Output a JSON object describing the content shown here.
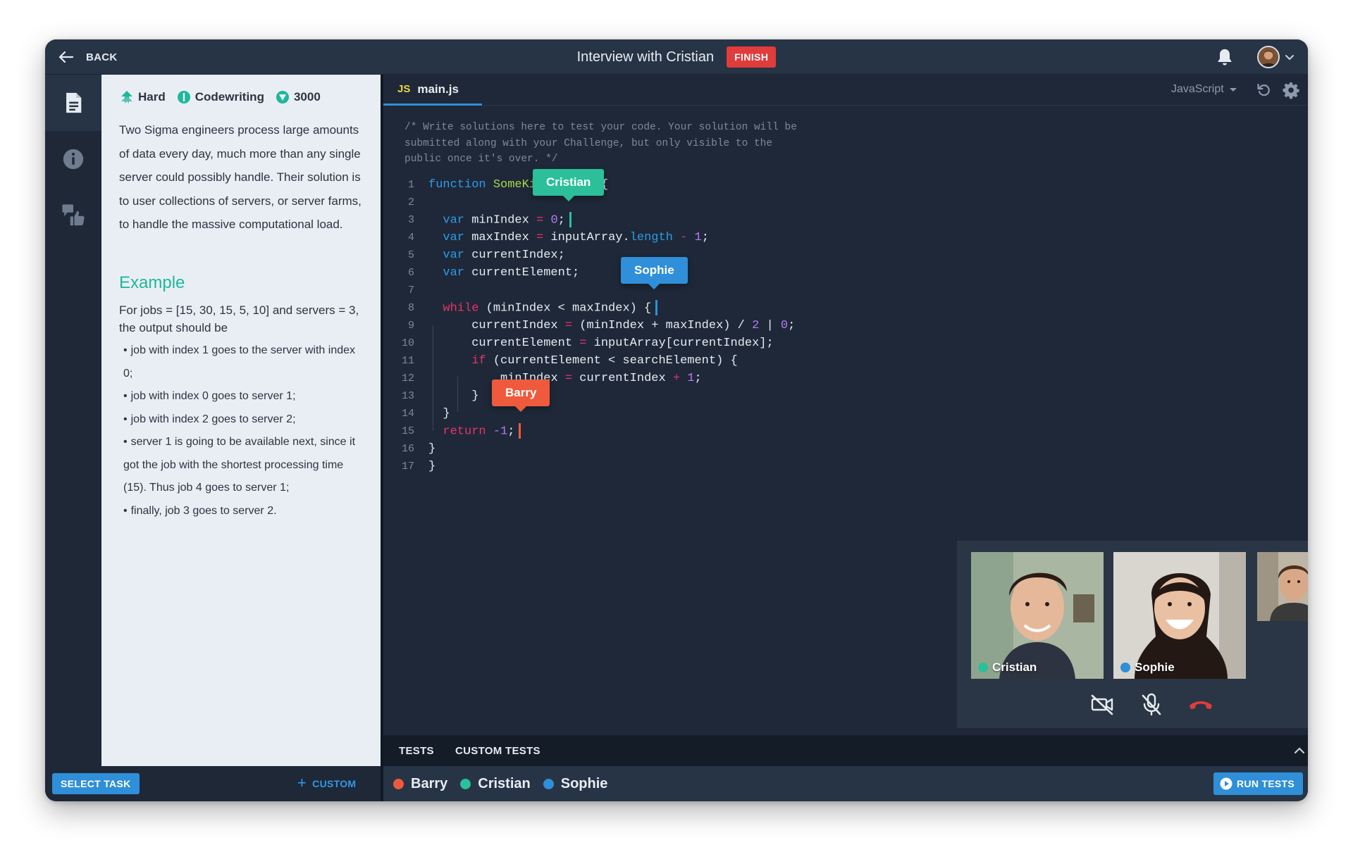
{
  "header": {
    "back_label": "BACK",
    "title": "Interview with Cristian",
    "finish_label": "FINISH"
  },
  "task": {
    "difficulty": "Hard",
    "category": "Codewriting",
    "points": "3000",
    "description": "Two Sigma engineers process large amounts of data every day, much more than any single server could possibly handle. Their solution is to user collections of servers, or server farms, to handle the massive computational load.",
    "example_heading": "Example",
    "example_intro": "For jobs = [15, 30, 15, 5, 10] and servers = 3, the output should be",
    "example_bullets": [
      "job with index 1 goes to the server with index 0;",
      "job with index 0 goes to server 1;",
      "job with index 2 goes to server 2;",
      "server 1 is going to be available next, since it got the job with the shortest processing time (15). Thus job 4 goes to server 1;",
      "finally, job 3 goes to server 2."
    ]
  },
  "left_footer": {
    "select_task_label": "SELECT TASK",
    "custom_label": "CUSTOM"
  },
  "editor": {
    "file_badge": "JS",
    "file_name": "main.js",
    "language": "JavaScript",
    "comment": "/* Write solutions here to test your code. Your solution will be\nsubmitted along with your Challenge, but only visible to the\npublic once it's over. */",
    "line_numbers": [
      "1",
      "2",
      "3",
      "4",
      "5",
      "6",
      "7",
      "8",
      "9",
      "10",
      "11",
      "12",
      "13",
      "14",
      "15",
      "16",
      "17"
    ],
    "code": {
      "l1_kw": "function",
      "l1_name": "SomeKindFind",
      "l1_rest": "() {",
      "var": "var",
      "l3_a": "minIndex",
      "l3_b": "0",
      "l4_a": "maxIndex",
      "l4_b": "inputArray.",
      "l4_c": "length",
      "l4_d": "1",
      "l5": "currentIndex;",
      "l6": "currentElement;",
      "while": "while",
      "l8_rest": "(minIndex < maxIndex) {",
      "l9_a": "currentIndex",
      "l9_b": "(minIndex + maxIndex) / ",
      "l9_c": "2",
      "l9_d": " | ",
      "l9_e": "0",
      "l10_a": "currentElement",
      "l10_b": "inputArray[currentIndex];",
      "if": "if",
      "l11_rest": "(currentElement < searchElement) {",
      "l12_a": "minIndex",
      "l12_b": "currentIndex",
      "l12_c": "1",
      "close": "}",
      "return": "return",
      "l15_val": "-1",
      "semi": ";",
      "eq": "=",
      "plus": "+",
      "minus": "-"
    }
  },
  "collaborators": {
    "cristian": {
      "name": "Cristian",
      "color": "#2bbf9a"
    },
    "sophie": {
      "name": "Sophie",
      "color": "#2f8fd8"
    },
    "barry": {
      "name": "Barry",
      "color": "#f05a3c"
    }
  },
  "video": {
    "tiles": [
      {
        "name": "Cristian"
      },
      {
        "name": "Sophie"
      }
    ]
  },
  "tests": {
    "tab_tests": "TESTS",
    "tab_custom": "CUSTOM TESTS",
    "run_label": "RUN TESTS"
  },
  "icons": {
    "back": "arrow-left-icon",
    "bell": "bell-icon",
    "description": "document-icon",
    "info": "info-icon",
    "feedback": "feedback-icon",
    "reset": "reset-icon",
    "settings": "gear-icon",
    "camera_off": "camera-off-icon",
    "mic_off": "mic-off-icon",
    "hangup": "phone-hangup-icon"
  }
}
